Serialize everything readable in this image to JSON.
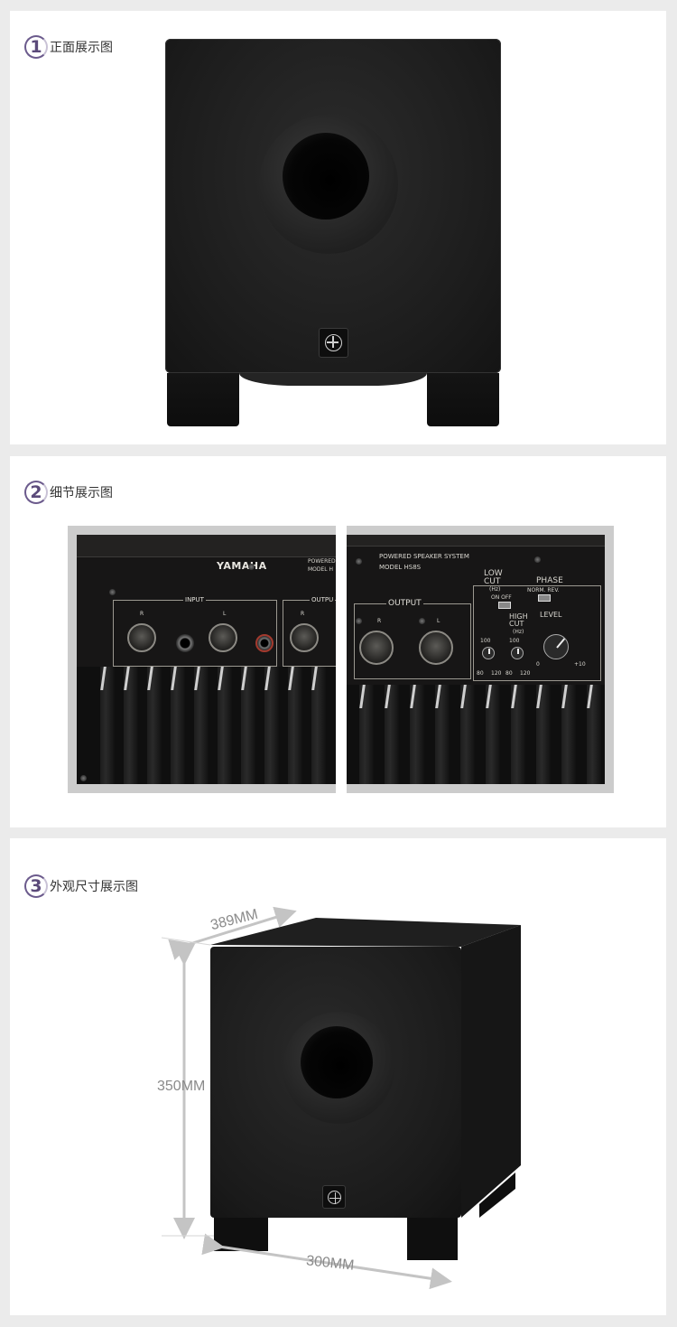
{
  "sections": [
    {
      "number": "1",
      "title": "正面展示图"
    },
    {
      "number": "2",
      "title": "细节展示图"
    },
    {
      "number": "3",
      "title": "外观尺寸展示图"
    }
  ],
  "detail_left": {
    "brand": "YAMAHA",
    "model_lines": [
      "POWERED",
      "MODEL H"
    ],
    "input_label": "INPUT",
    "output_label": "OUTPU",
    "r_label": "R",
    "l_label": "L",
    "out_r_label": "R"
  },
  "detail_right": {
    "header_line1": "POWERED SPEAKER SYSTEM",
    "header_line2": "MODEL HS8S",
    "output_label": "OUTPUT",
    "r_label": "R",
    "l_label": "L",
    "low_cut": "LOW",
    "low_cut2": "CUT",
    "low_cut_hz": "(Hz)",
    "on_off": "ON OFF",
    "phase": "PHASE",
    "norm_rev": "NORM.  REV.",
    "high_cut": "HIGH",
    "high_cut2": "CUT",
    "high_cut_hz": "(Hz)",
    "level": "LEVEL",
    "k1": "100",
    "k1_low": "80",
    "k1_high": "120",
    "k2": "100",
    "k2_low": "80",
    "k2_high": "120",
    "lvl_min": "0",
    "lvl_max": "+10"
  },
  "dimensions": {
    "depth": "389MM",
    "height": "350MM",
    "width": "300MM"
  }
}
